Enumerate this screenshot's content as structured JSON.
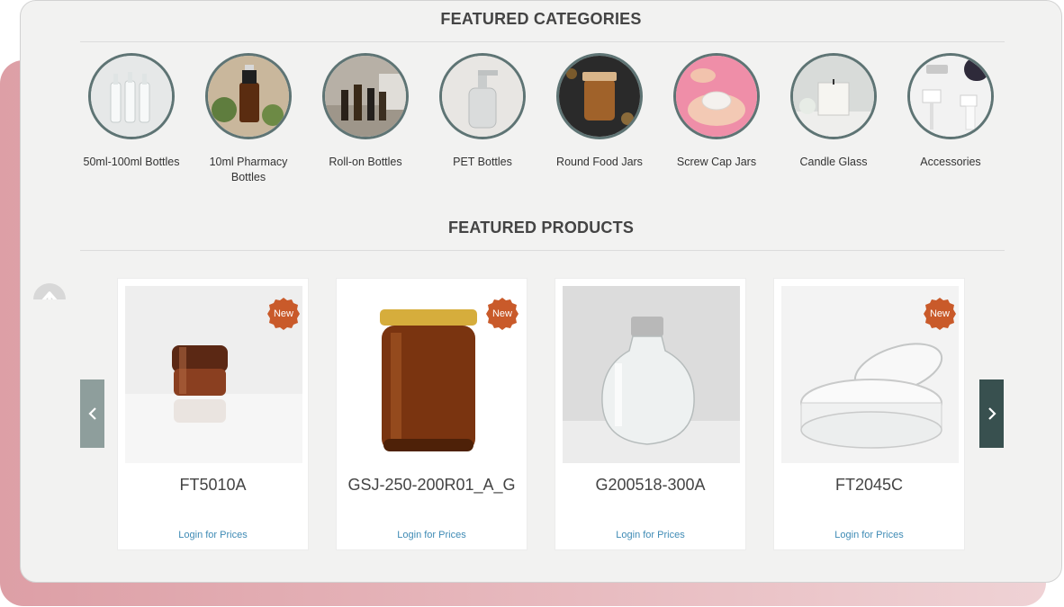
{
  "featured_categories": {
    "title": "FEATURED CATEGORIES",
    "items": [
      {
        "label": "50ml-100ml Bottles",
        "icon": "glass-bottles-image"
      },
      {
        "label": "10ml Pharmacy Bottles",
        "icon": "amber-pharmacy-bottle-image"
      },
      {
        "label": "Roll-on Bottles",
        "icon": "roll-on-bottles-image"
      },
      {
        "label": "PET Bottles",
        "icon": "pump-bottle-image"
      },
      {
        "label": "Round Food Jars",
        "icon": "food-jar-image"
      },
      {
        "label": "Screw Cap Jars",
        "icon": "cream-jar-image"
      },
      {
        "label": "Candle Glass",
        "icon": "candle-glass-image"
      },
      {
        "label": "Accessories",
        "icon": "pump-caps-image"
      }
    ]
  },
  "featured_products": {
    "title": "FEATURED PRODUCTS",
    "badge_label": "New",
    "products": [
      {
        "sku": "FT5010A",
        "price_link": "Login for Prices",
        "is_new": true,
        "image": "amber-cream-jar"
      },
      {
        "sku": "GSJ-250-200R01_A_G",
        "price_link": "Login for Prices",
        "is_new": true,
        "image": "amber-jar-gold-lid"
      },
      {
        "sku": "G200518-300A",
        "price_link": "Login for Prices",
        "is_new": false,
        "image": "clear-round-bottle"
      },
      {
        "sku": "FT2045C",
        "price_link": "Login for Prices",
        "is_new": true,
        "image": "clear-plastic-jar"
      }
    ],
    "prev_icon": "chevron-left-icon",
    "next_icon": "chevron-right-icon"
  },
  "colors": {
    "badge": "#c95a2a",
    "circle_border": "#5e7474",
    "link": "#3f8bb5",
    "next_arrow": "#38504f",
    "prev_arrow": "#8e9e9c"
  }
}
